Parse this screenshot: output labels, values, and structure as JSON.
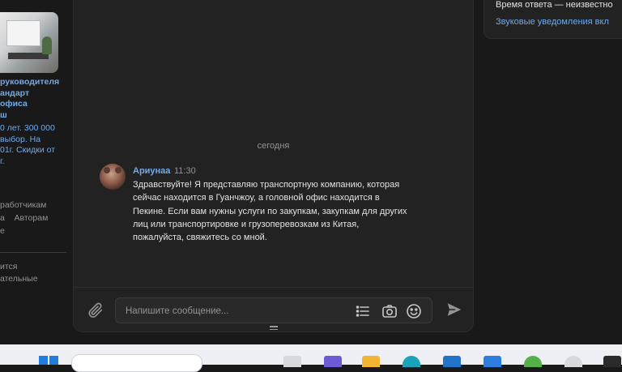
{
  "left_column": {
    "ad_title_lines": [
      "руководителя",
      "андарт",
      "офиса",
      "ш"
    ],
    "ad_desc_lines": [
      "0 лет. 300 000",
      "выбор. На",
      "01г. Скидки от",
      "г."
    ],
    "links": [
      "работчикам",
      "а    Авторам",
      "е"
    ],
    "footer_lines": [
      "ится",
      "ательные"
    ]
  },
  "chat": {
    "date_separator": "сегодня",
    "message": {
      "sender": "Ариунаа",
      "time": "11:30",
      "text": "Здравствуйте! Я представляю транспортную компанию, которая сейчас находится в Гуанчжоу, а головной офис находится в Пекине. Если вам нужны услуги по закупкам, закупкам для других лиц или транспортировке и грузоперевозкам из Китая, пожалуйста, свяжитесь со мной."
    },
    "composer": {
      "placeholder": "Напишите сообщение...",
      "value": ""
    }
  },
  "right_panel": {
    "response_time": "Время ответа — неизвестно",
    "sound_notifications": "Звуковые уведомления вкл"
  },
  "colors": {
    "background": "#191919",
    "panel": "#222222",
    "accent": "#71aaeb",
    "muted_text": "#939393",
    "text": "#e1e3e6"
  },
  "icons": [
    "paperclip-icon",
    "list-icon",
    "camera-icon",
    "emoji-icon",
    "send-icon",
    "drag-handle-icon"
  ]
}
